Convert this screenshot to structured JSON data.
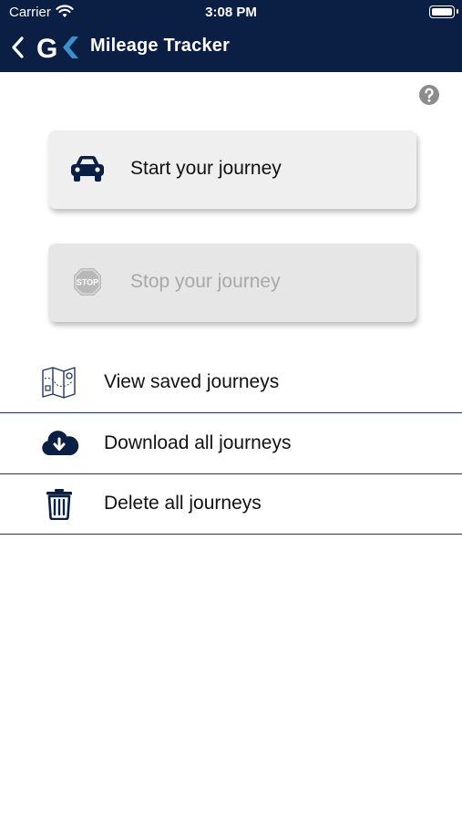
{
  "status_bar": {
    "carrier": "Carrier",
    "time": "3:08 PM"
  },
  "nav": {
    "title": "Mileage Tracker",
    "logo_text": "GK"
  },
  "actions": {
    "start_label": "Start your journey",
    "stop_label": "Stop your journey",
    "stop_sign_text": "STOP"
  },
  "menu": {
    "items": [
      {
        "label": "View saved journeys",
        "icon": "map-icon"
      },
      {
        "label": "Download all journeys",
        "icon": "cloud-download-icon"
      },
      {
        "label": "Delete all journeys",
        "icon": "trash-icon"
      }
    ]
  },
  "colors": {
    "header": "#0b1f44",
    "accent": "#1e3563",
    "card": "#efefef",
    "disabled_text": "#a8a8a8"
  }
}
